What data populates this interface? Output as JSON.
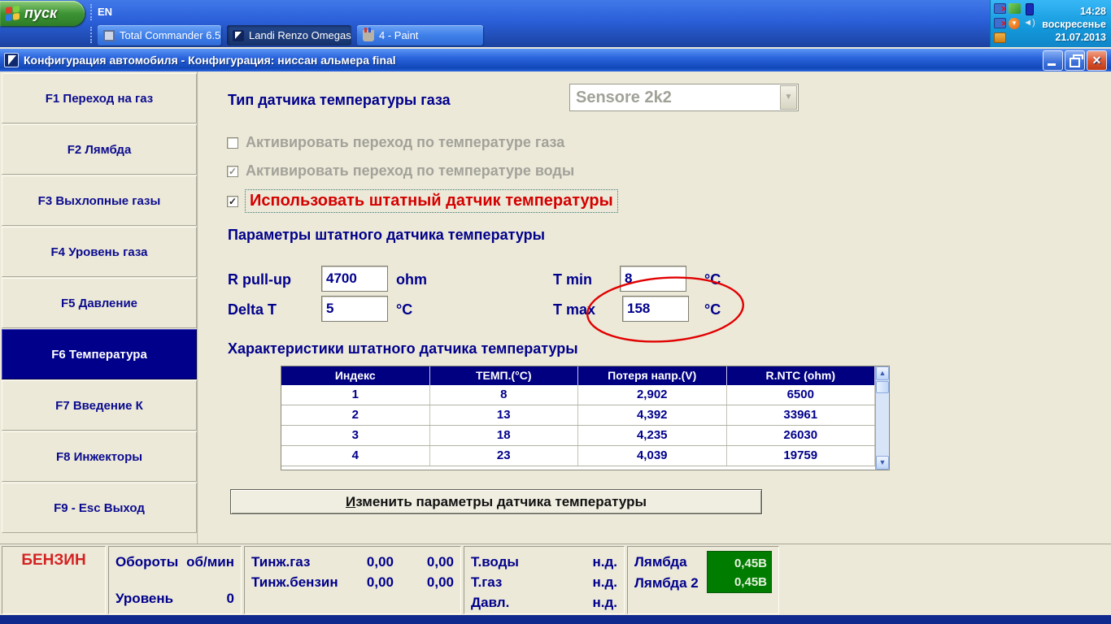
{
  "taskbar": {
    "start_label": "пуск",
    "language": "EN",
    "tasks": [
      {
        "label": "Total Commander 6.5...",
        "icon": "floppy-icon"
      },
      {
        "label": "Landi Renzo Omegas",
        "icon": "sailboat-icon",
        "active": true
      },
      {
        "label": "4 - Paint",
        "icon": "paint-icon"
      }
    ],
    "tray": {
      "icons": [
        "network-offline-icon",
        "updates-icon",
        "battery-icon",
        "network-error-icon",
        "download-master-icon",
        "volume-icon",
        "scheduler-icon"
      ],
      "volume_glyph": "◄)",
      "time": "14:28",
      "day": "воскресенье",
      "date": "21.07.2013"
    }
  },
  "window": {
    "title": "Конфигурация автомобиля - Конфигурация: ниссан альмера final",
    "close_glyph": "✕"
  },
  "sidebar": {
    "items": [
      {
        "label": "F1 Переход на газ"
      },
      {
        "label": "F2 Лямбда"
      },
      {
        "label": "F3 Выхлопные газы"
      },
      {
        "label": "F4 Уровень газа"
      },
      {
        "label": "F5 Давление"
      },
      {
        "label": "F6 Температура",
        "active": true
      },
      {
        "label": "F7 Введение К"
      },
      {
        "label": "F8 Инжекторы"
      },
      {
        "label": "F9 - Esc Выход"
      }
    ]
  },
  "main": {
    "sensor_type_label": "Тип датчика температуры газа",
    "sensor_type_value": "Sensore 2k2",
    "combo_arrow": "▼",
    "check_glyph": "✓",
    "checkboxes": [
      {
        "label": "Активировать переход по температуре газа",
        "checked": false,
        "disabled": true
      },
      {
        "label": "Активировать переход по температуре воды",
        "checked": true,
        "disabled": true
      },
      {
        "label": "Использовать штатный датчик температуры",
        "checked": true,
        "disabled": false
      }
    ],
    "params_heading": "Параметры штатного датчика температуры",
    "params": {
      "r_pullup_label": "R pull-up",
      "r_pullup_value": "4700",
      "r_pullup_unit": "ohm",
      "delta_t_label": "Delta T",
      "delta_t_value": "5",
      "delta_t_unit": "°C",
      "t_min_label": "T min",
      "t_min_value": "8",
      "t_min_unit": "°C",
      "t_max_label": "T max",
      "t_max_value": "158",
      "t_max_unit": "°C"
    },
    "annotation_color": "#e10000",
    "table_heading": "Характеристики штатного датчика температуры",
    "table": {
      "headers": [
        "Индекс",
        "ТЕМП.(°C)",
        "Потеря напр.(V)",
        "R.NTC (ohm)"
      ],
      "rows": [
        [
          "1",
          "8",
          "2,902",
          "6500"
        ],
        [
          "2",
          "13",
          "4,392",
          "33961"
        ],
        [
          "3",
          "18",
          "4,235",
          "26030"
        ],
        [
          "4",
          "23",
          "4,039",
          "19759"
        ]
      ],
      "scroll_up_glyph": "▲",
      "scroll_down_glyph": "▼"
    },
    "edit_button_prefix": "И",
    "edit_button_rest": "зменить параметры датчика температуры"
  },
  "statusbar": {
    "fuel": "БЕНЗИН",
    "rpm_label": "Обороты",
    "rpm_unit": "об/мин",
    "level_label": "Уровень",
    "level_value": "0",
    "tinj_gas_label": "Тинж.газ",
    "tinj_gas_v1": "0,00",
    "tinj_gas_v2": "0,00",
    "tinj_petrol_label": "Тинж.бензин",
    "tinj_petrol_v1": "0,00",
    "tinj_petrol_v2": "0,00",
    "t_water_label": "Т.воды",
    "t_water_value": "н.д.",
    "t_gas_label": "Т.газ",
    "t_gas_value": "н.д.",
    "pressure_label": "Давл.",
    "pressure_value": "н.д.",
    "lambda_label": "Лямбда",
    "lambda_value": "0,45В",
    "lambda2_label": "Лямбда 2",
    "lambda2_value": "0,45В",
    "status_green": "#007d00"
  }
}
